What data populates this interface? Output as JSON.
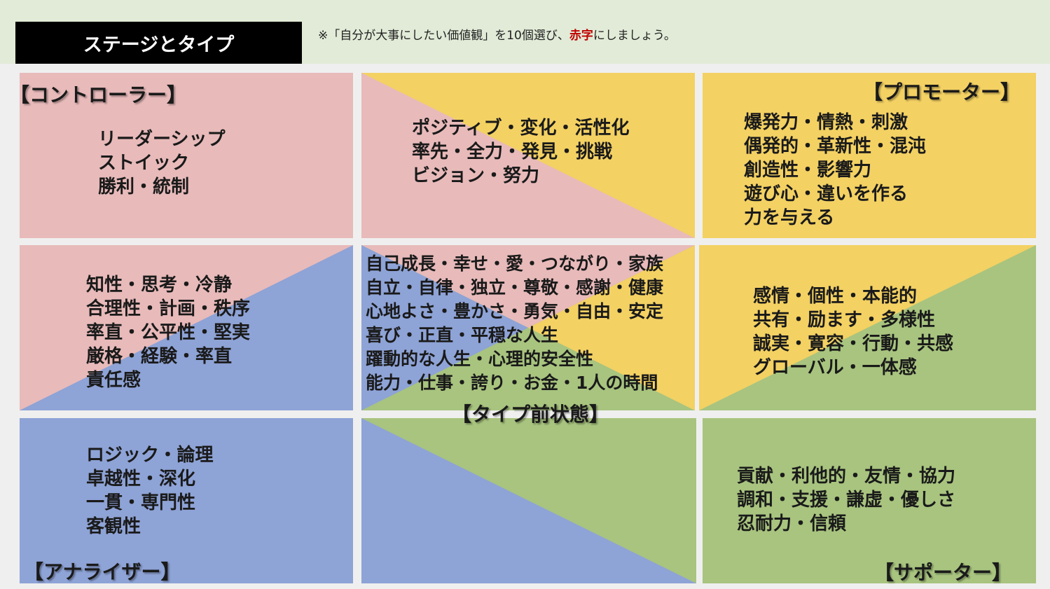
{
  "header": {
    "title": "ステージとタイプ",
    "instruction_prefix": "※「自分が大事にしたい価値観」を10個選び、",
    "instruction_red": "赤字",
    "instruction_suffix": "にしましょう。"
  },
  "colors": {
    "pink": "#e8baba",
    "yellow": "#f3d163",
    "blue": "#8ea3d6",
    "green": "#a8c47f",
    "header_band": "#e1ebd7",
    "accent_red": "#c00000"
  },
  "cells": {
    "controller": {
      "label": "【コントローラー】",
      "lines": [
        "リーダーシップ",
        "ストイック",
        "勝利・統制"
      ]
    },
    "controller_promoter": {
      "lines": [
        "ポジティブ・変化・活性化",
        "率先・全力・発見・挑戦",
        "ビジョン・努力"
      ]
    },
    "promoter": {
      "label": "【プロモーター】",
      "lines": [
        "爆発力・情熱・刺激",
        "偶発的・革新性・混沌",
        "創造性・影響力",
        "遊び心・違いを作る",
        "力を与える"
      ]
    },
    "controller_analyzer": {
      "lines": [
        "知性・思考・冷静",
        "合理性・計画・秩序",
        "率直・公平性・堅実",
        "厳格・経験・率直",
        "責任感"
      ]
    },
    "center": {
      "label": "【タイプ前状態】",
      "lines": [
        "自己成長・幸せ・愛・つながり・家族",
        "自立・自律・独立・尊敬・感謝・健康",
        "心地よさ・豊かさ・勇気・自由・安定",
        "喜び・正直・平穏な人生",
        "躍動的な人生・心理的安全性",
        "能力・仕事・誇り・お金・1人の時間"
      ]
    },
    "promoter_supporter": {
      "lines": [
        "感情・個性・本能的",
        "共有・励ます・多様性",
        "誠実・寛容・行動・共感",
        "グローバル・一体感"
      ]
    },
    "analyzer": {
      "label": "【アナライザー】",
      "lines": [
        "ロジック・論理",
        "卓越性・深化",
        "一貫・専門性",
        "客観性"
      ]
    },
    "supporter": {
      "label": "【サポーター】",
      "lines": [
        "貢献・利他的・友情・協力",
        "調和・支援・謙虚・優しさ",
        "忍耐力・信頼"
      ]
    }
  }
}
